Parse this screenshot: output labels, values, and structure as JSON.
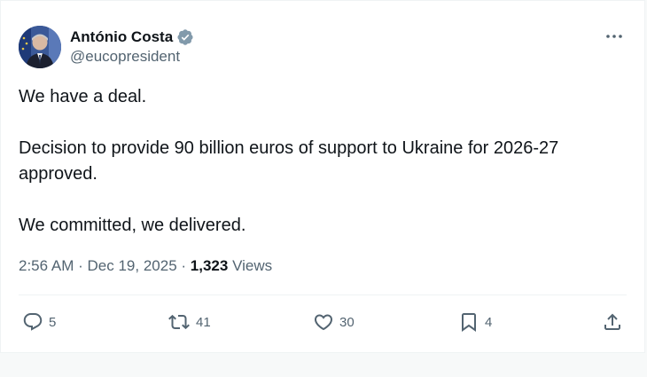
{
  "tweet": {
    "author": {
      "display_name": "António Costa",
      "handle": "@eucopresident",
      "verified": true
    },
    "text": "We have a deal.\n\nDecision to provide 90 billion euros of support to Ukraine for 2026-27 approved.\n\nWe committed, we delivered.",
    "time": "2:56 AM",
    "sep1": "·",
    "date": "Dec 19, 2025",
    "sep2": "·",
    "views_count": "1,323",
    "views_label": "Views"
  },
  "actions": {
    "reply_count": "5",
    "retweet_count": "41",
    "like_count": "30",
    "bookmark_count": "4"
  },
  "icons": {
    "verified": "verified-badge-icon",
    "more": "more-options-icon",
    "reply": "reply-icon",
    "retweet": "retweet-icon",
    "like": "heart-icon",
    "bookmark": "bookmark-icon",
    "share": "share-icon"
  },
  "colors": {
    "primary_text": "#0f1419",
    "secondary_text": "#536471",
    "border": "#eff3f4",
    "verified_badge": "#829aab"
  }
}
